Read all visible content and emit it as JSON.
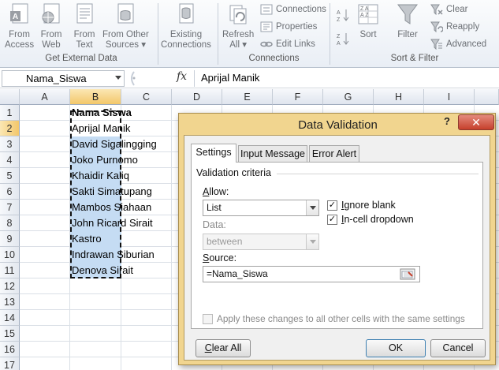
{
  "ribbon": {
    "buttons": [
      {
        "line1": "From",
        "line2": "Access"
      },
      {
        "line1": "From",
        "line2": "Web"
      },
      {
        "line1": "From",
        "line2": "Text"
      },
      {
        "line1": "From Other",
        "line2": "Sources ▾"
      },
      {
        "line1": "Existing",
        "line2": "Connections"
      },
      {
        "line1": "Refresh",
        "line2": "All ▾"
      }
    ],
    "connections": {
      "connections": "Connections",
      "properties": "Properties",
      "edit_links": "Edit Links"
    },
    "sort": {
      "sort_label": "Sort",
      "az": "A→Z",
      "za": "Z→A"
    },
    "filter": {
      "filter_label": "Filter",
      "clear": "Clear",
      "reapply": "Reapply",
      "advanced": "Advanced"
    },
    "groups": {
      "get_external": "Get External Data",
      "connections": "Connections",
      "sort_filter": "Sort & Filter"
    }
  },
  "formula_bar": {
    "name_box": "Nama_Siswa",
    "fx": "fx",
    "value": "Aprijal Manik"
  },
  "sheet": {
    "columns": [
      "A",
      "B",
      "C",
      "D",
      "E",
      "F",
      "G",
      "H",
      "I"
    ],
    "rows": [
      "1",
      "2",
      "3",
      "4",
      "5",
      "6",
      "7",
      "8",
      "9",
      "10",
      "11",
      "12",
      "13",
      "14",
      "15",
      "16",
      "17"
    ],
    "header_cell": "Nama Siswa",
    "names": [
      "Aprijal Manik",
      "David Sigalingging",
      "Joko Purnomo",
      "Khaidir Kaliq",
      "Sakti Simatupang",
      "Mambos Siahaan",
      "John Ricard Sirait",
      "Kastro",
      "Indrawan Siburian",
      "Denova Sirait"
    ]
  },
  "dialog": {
    "title": "Data Validation",
    "help": "?",
    "close": "✕",
    "tabs": [
      "Settings",
      "Input Message",
      "Error Alert"
    ],
    "criteria_label": "Validation criteria",
    "allow_label": "Allow:",
    "allow_value": "List",
    "data_label": "Data:",
    "data_value": "between",
    "ignore_blank": "Ignore blank",
    "in_cell_dropdown": "In-cell dropdown",
    "source_label": "Source:",
    "source_value": "=Nama_Siswa",
    "apply_all": "Apply these changes to all other cells with the same settings",
    "clear_all": "Clear All",
    "ok": "OK",
    "cancel": "Cancel",
    "checkmark": "✓"
  },
  "colors": {
    "selection_fill": "#c5dcf3",
    "dialog_frame": "#f1d58f",
    "close_button": "#c6402c",
    "header_selected": "#f3c76a"
  },
  "icons": [
    "access-icon",
    "web-icon",
    "text-file-icon",
    "other-sources-icon",
    "existing-connections-icon",
    "refresh-icon",
    "connections-icon",
    "properties-icon",
    "edit-links-icon",
    "sort-az-icon",
    "sort-za-icon",
    "sort-icon",
    "filter-icon",
    "clear-icon",
    "reapply-icon",
    "advanced-icon",
    "range-picker-icon"
  ]
}
